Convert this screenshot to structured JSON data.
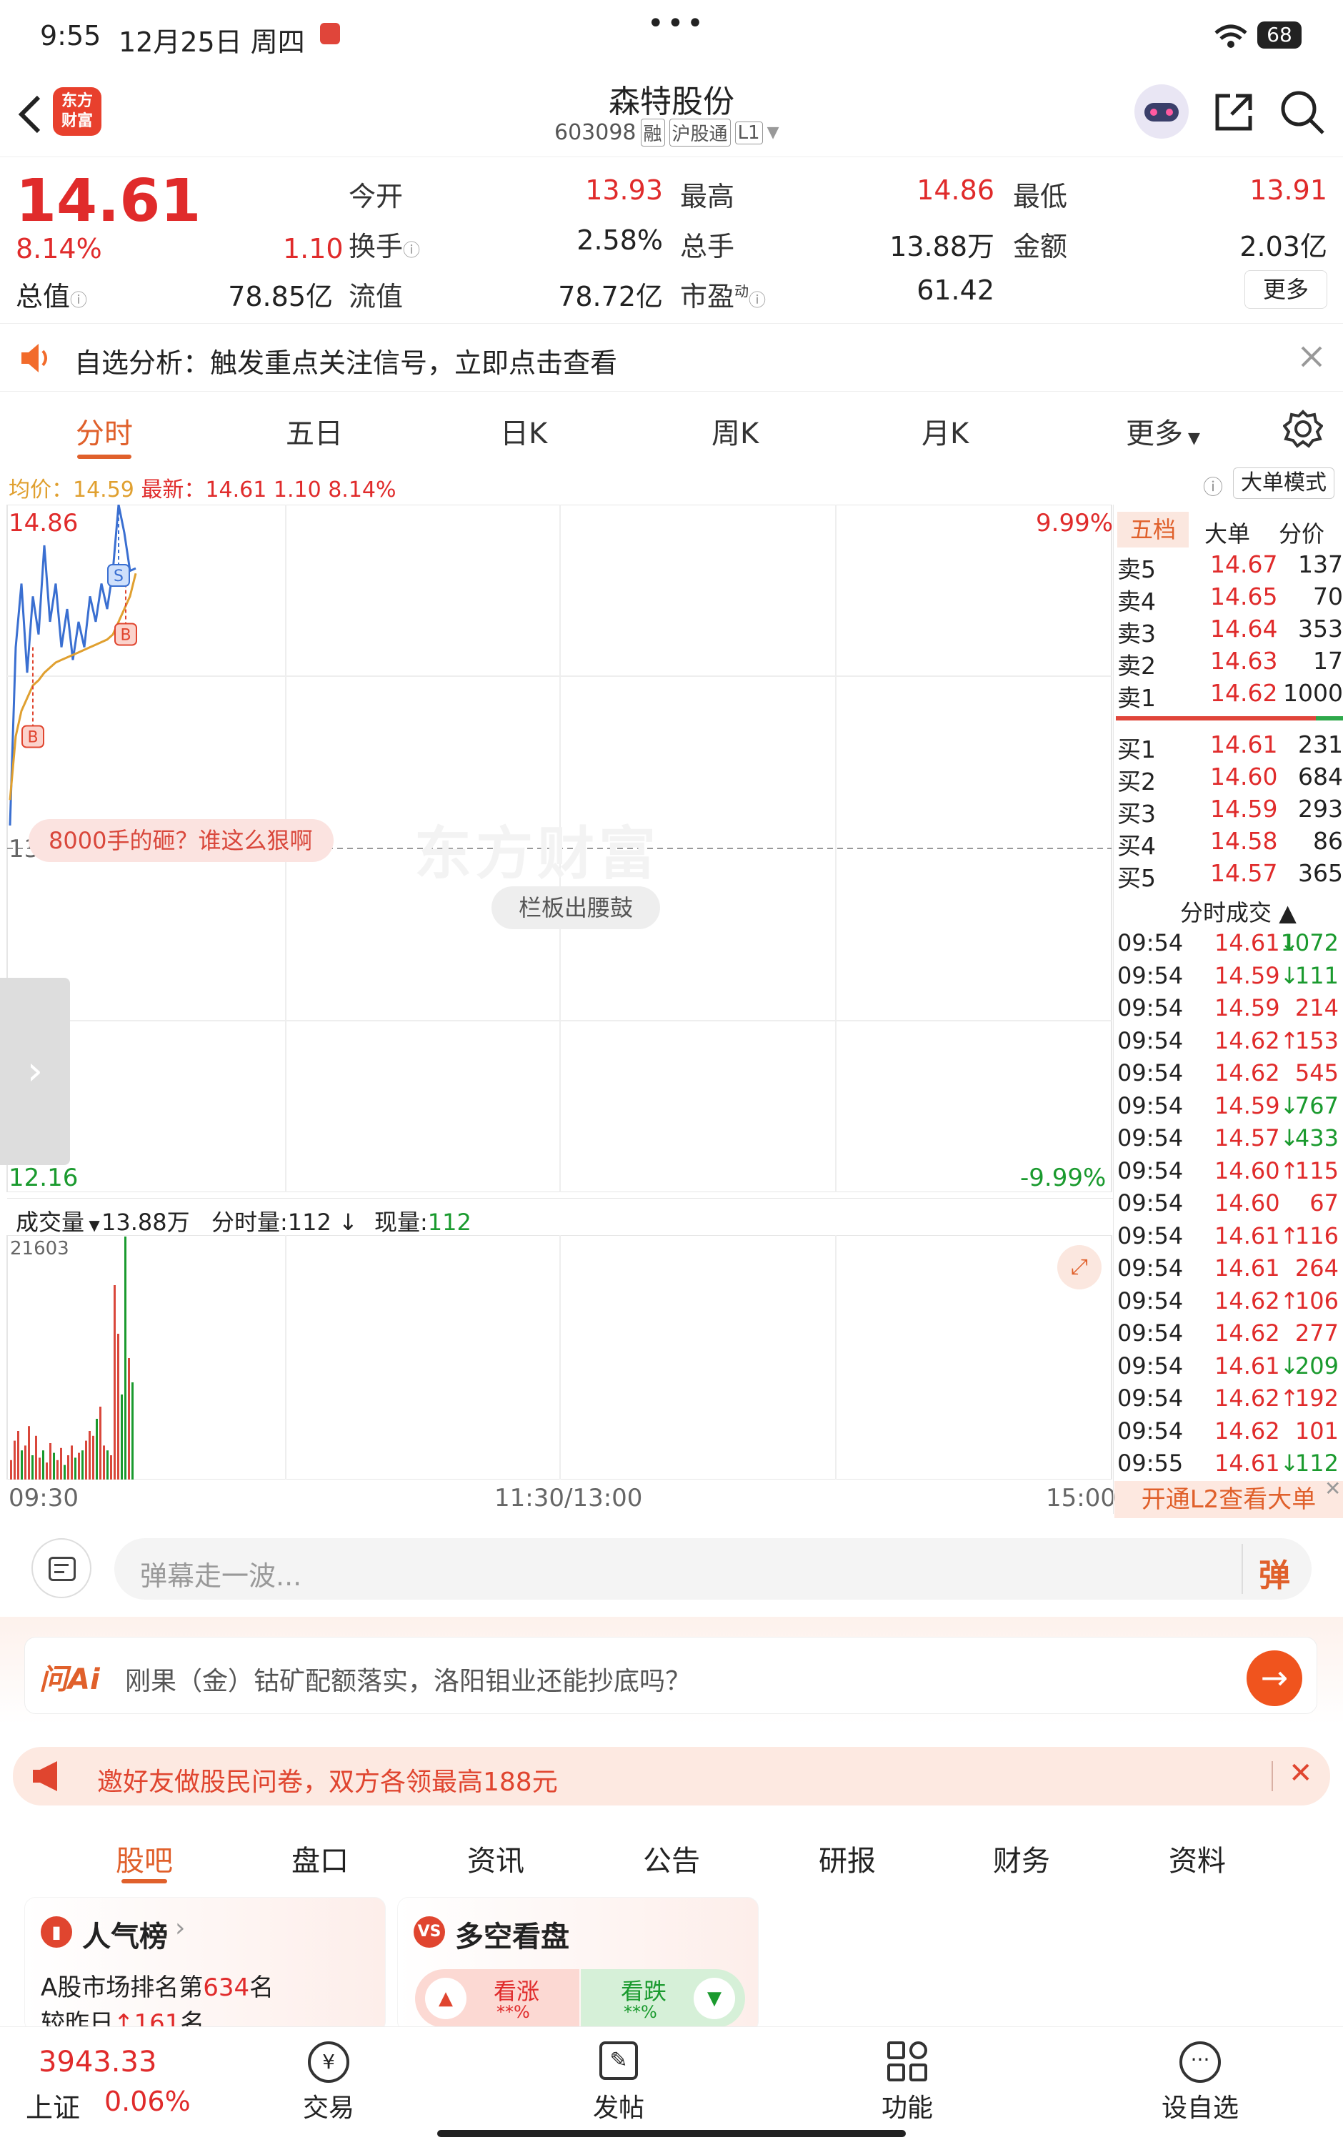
{
  "status": {
    "time": "9:55",
    "date": "12月25日 周四",
    "battery": "68"
  },
  "header": {
    "title": "森特股份",
    "code": "603098",
    "tag_rong": "融",
    "tag_hgt": "沪股通",
    "tag_l1": "L1",
    "logo_line1": "东方",
    "logo_line2": "财富"
  },
  "quote": {
    "price": "14.61",
    "pct": "8.14%",
    "change": "1.10",
    "today_open_label": "今开",
    "today_open": "13.93",
    "high_label": "最高",
    "high": "14.86",
    "low_label": "最低",
    "low": "13.91",
    "turnover_label": "换手",
    "turnover": "2.58%",
    "volume_label": "总手",
    "volume": "13.88万",
    "amount_label": "金额",
    "amount": "2.03亿",
    "mktcap_label": "总值",
    "mktcap": "78.85亿",
    "float_label": "流值",
    "float": "78.72亿",
    "pe_label": "市盈",
    "pe_sup": "动",
    "pe": "61.42",
    "more": "更多"
  },
  "notice": {
    "text": "自选分析：触发重点关注信号，立即点击查看"
  },
  "tabs": [
    "分时",
    "五日",
    "日K",
    "周K",
    "月K",
    "更多"
  ],
  "chart_info": {
    "avg_label": "均价：",
    "avg": "14.59",
    "latest_label": "最新：",
    "latest": "14.61",
    "chg": "1.10",
    "pct": "8.14%",
    "big_mode": "大单模式"
  },
  "chart_data": {
    "type": "line",
    "title": "",
    "y_top": "14.86",
    "y_mid": "13.51",
    "y_bottom": "12.16",
    "pct_top": "9.99%",
    "pct_bottom": "-9.99%",
    "x_labels": [
      "09:30",
      "11:30/13:00",
      "15:00"
    ],
    "ylim": [
      12.16,
      14.86
    ],
    "series": [
      {
        "values": [
          13.6,
          14.3,
          14.55,
          14.2,
          14.5,
          14.35,
          14.7,
          14.4,
          14.55,
          14.3,
          14.45,
          14.25,
          14.4,
          14.3,
          14.5,
          14.4,
          14.55,
          14.45,
          14.6,
          14.86,
          14.75,
          14.6,
          14.61
        ]
      },
      {
        "values": [
          13.7,
          13.95,
          14.05,
          14.1,
          14.15,
          14.17,
          14.2,
          14.22,
          14.24,
          14.25,
          14.26,
          14.27,
          14.28,
          14.29,
          14.3,
          14.31,
          14.32,
          14.33,
          14.35,
          14.4,
          14.45,
          14.5,
          14.59
        ]
      }
    ],
    "markers": [
      "B",
      "B",
      "S"
    ],
    "banner": "8000手的砸？谁这么狠啊",
    "watermark": "东方财富",
    "chip": "栏板出腰鼓"
  },
  "volume": {
    "label": "成交量",
    "total": "13.88万",
    "min_label": "分时量:",
    "min_val": "112",
    "now_label": "现量:",
    "now_val": "112",
    "max": "21603",
    "bars": [
      8,
      16,
      20,
      12,
      14,
      22,
      10,
      18,
      9,
      12,
      7,
      15,
      11,
      8,
      13,
      6,
      10,
      14,
      9,
      11,
      12,
      16,
      20,
      18,
      25,
      30,
      14,
      12,
      10,
      80,
      60,
      35,
      100,
      50,
      40
    ],
    "colors": [
      "r",
      "r",
      "r",
      "g",
      "r",
      "r",
      "g",
      "r",
      "r",
      "g",
      "r",
      "r",
      "g",
      "r",
      "r",
      "g",
      "r",
      "r",
      "g",
      "r",
      "g",
      "r",
      "r",
      "r",
      "g",
      "r",
      "r",
      "g",
      "r",
      "r",
      "r",
      "g",
      "g",
      "r",
      "g"
    ]
  },
  "orderbook": {
    "tabs": [
      "五档",
      "大单",
      "分价"
    ],
    "asks": [
      {
        "label": "卖5",
        "price": "14.67",
        "vol": "137"
      },
      {
        "label": "卖4",
        "price": "14.65",
        "vol": "70"
      },
      {
        "label": "卖3",
        "price": "14.64",
        "vol": "353"
      },
      {
        "label": "卖2",
        "price": "14.63",
        "vol": "17"
      },
      {
        "label": "卖1",
        "price": "14.62",
        "vol": "1000"
      }
    ],
    "bids": [
      {
        "label": "买1",
        "price": "14.61",
        "vol": "231"
      },
      {
        "label": "买2",
        "price": "14.60",
        "vol": "684"
      },
      {
        "label": "买3",
        "price": "14.59",
        "vol": "293"
      },
      {
        "label": "买4",
        "price": "14.58",
        "vol": "86"
      },
      {
        "label": "买5",
        "price": "14.57",
        "vol": "365"
      }
    ],
    "trades_title": "分时成交",
    "trades": [
      {
        "t": "09:54",
        "p": "14.61",
        "a": "↓",
        "v": "1072",
        "c": "g"
      },
      {
        "t": "09:54",
        "p": "14.59",
        "a": "↓",
        "v": "111",
        "c": "g"
      },
      {
        "t": "09:54",
        "p": "14.59",
        "a": "",
        "v": "214",
        "c": "r"
      },
      {
        "t": "09:54",
        "p": "14.62",
        "a": "↑",
        "v": "153",
        "c": "r"
      },
      {
        "t": "09:54",
        "p": "14.62",
        "a": "",
        "v": "545",
        "c": "r"
      },
      {
        "t": "09:54",
        "p": "14.59",
        "a": "↓",
        "v": "767",
        "c": "g"
      },
      {
        "t": "09:54",
        "p": "14.57",
        "a": "↓",
        "v": "433",
        "c": "g"
      },
      {
        "t": "09:54",
        "p": "14.60",
        "a": "↑",
        "v": "115",
        "c": "r"
      },
      {
        "t": "09:54",
        "p": "14.60",
        "a": "",
        "v": "67",
        "c": "r"
      },
      {
        "t": "09:54",
        "p": "14.61",
        "a": "↑",
        "v": "116",
        "c": "r"
      },
      {
        "t": "09:54",
        "p": "14.61",
        "a": "",
        "v": "264",
        "c": "r"
      },
      {
        "t": "09:54",
        "p": "14.62",
        "a": "↑",
        "v": "106",
        "c": "r"
      },
      {
        "t": "09:54",
        "p": "14.62",
        "a": "",
        "v": "277",
        "c": "r"
      },
      {
        "t": "09:54",
        "p": "14.61",
        "a": "↓",
        "v": "209",
        "c": "g"
      },
      {
        "t": "09:54",
        "p": "14.62",
        "a": "↑",
        "v": "192",
        "c": "r"
      },
      {
        "t": "09:54",
        "p": "14.62",
        "a": "",
        "v": "101",
        "c": "r"
      },
      {
        "t": "09:55",
        "p": "14.61",
        "a": "↓",
        "v": "112",
        "c": "g"
      }
    ],
    "l2": "开通L2查看大单"
  },
  "danmu": {
    "placeholder": "弹幕走一波...",
    "btn": "弹"
  },
  "ai": {
    "logo": "问Ai",
    "text": "刚果（金）钴矿配额落实，洛阳钼业还能抄底吗？"
  },
  "promo": {
    "text": "邀好友做股民问卷，双方各领最高188元"
  },
  "bottom_tabs": [
    "股吧",
    "盘口",
    "资讯",
    "公告",
    "研报",
    "财务",
    "资料"
  ],
  "cards": {
    "hot": {
      "title": "人气榜",
      "line1_a": "A股市场排名第",
      "rank": "634",
      "line1_b": "名",
      "line2_a": "较昨日",
      "rise": "161",
      "line2_b": "名"
    },
    "ls": {
      "title": "多空看盘",
      "up": "看涨",
      "down": "看跌",
      "up_pct": "**%",
      "down_pct": "**%"
    }
  },
  "bottombar": {
    "index_val": "3943.33",
    "index_name": "上证",
    "index_pct": "0.06%",
    "trade": "交易",
    "post": "发帖",
    "func": "功能",
    "watch": "设自选"
  }
}
